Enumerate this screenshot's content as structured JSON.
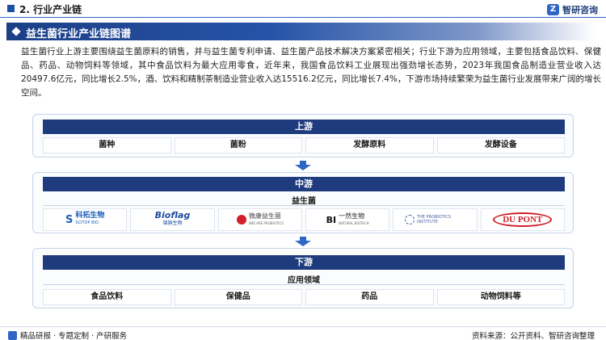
{
  "header": {
    "section": "2. 行业产业链",
    "brand": "智研咨询",
    "brand_mark": "Z"
  },
  "banner": {
    "title": "益生菌行业产业链图谱"
  },
  "intro": "益生菌行业上游主要围绕益生菌原料的销售，并与益生菌专利申请、益生菌产品技术解决方案紧密相关；行业下游为应用领域，主要包括食品饮料、保健品、药品、动物饲料等领域，其中食品饮料为最大应用零食，近年来，我国食品饮料工业展现出强劲增长态势，2023年我国食品制造业营业收入达20497.6亿元，同比增长2.5%，酒、饮料和精制茶制造业营业收入达15516.2亿元，同比增长7.4%，下游市场持续繁荣为益生菌行业发展带来广阔的增长空间。",
  "upstream": {
    "title": "上游",
    "items": [
      "菌种",
      "菌粉",
      "发酵原料",
      "发酵设备"
    ]
  },
  "midstream": {
    "title": "中游",
    "subtitle": "益生菌",
    "companies": [
      {
        "name": "科拓生物",
        "sub": "SCITOP BIO",
        "color": "#1f5fb8"
      },
      {
        "name": "Bioflag",
        "sub": "锦旗生物",
        "color": "#1f4da0"
      },
      {
        "name": "微康益生菌",
        "sub": "WECARE PROBIOTICS",
        "color": "#444444"
      },
      {
        "name": "一然生物",
        "sub": "NATURAL BIOTECH",
        "color": "#222222"
      },
      {
        "name": "THE PROBIOTICS INSTITUTE",
        "sub": "",
        "color": "#4a5fa5"
      },
      {
        "name": "DU PONT",
        "sub": "",
        "color": "#d0202a"
      }
    ]
  },
  "downstream": {
    "title": "下游",
    "subtitle": "应用领域",
    "items": [
      "食品饮料",
      "保健品",
      "药品",
      "动物饲料等"
    ]
  },
  "footer": {
    "left": "精品研报 · 专题定制 · 产研服务",
    "source": "资料来源：公开资料、智研咨询整理"
  }
}
